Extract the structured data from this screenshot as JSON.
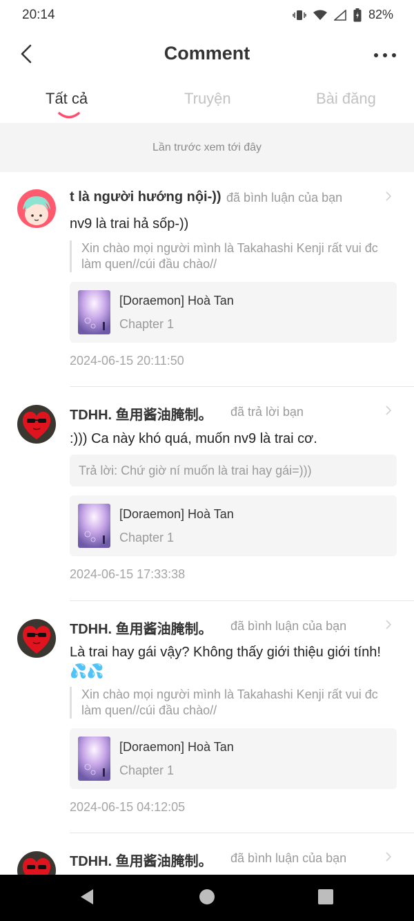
{
  "status": {
    "time": "20:14",
    "battery": "82%"
  },
  "header": {
    "title": "Comment"
  },
  "tabs": [
    {
      "label": "Tất cả"
    },
    {
      "label": "Truyện"
    },
    {
      "label": "Bài đăng"
    }
  ],
  "notice": "Lần trước xem tới đây",
  "items": [
    {
      "user": "t là người hướng nội-))",
      "action": "đã bình luận của bạn",
      "comment": "nv9 là trai hả sốp-))",
      "quote": "Xin chào mọi người mình là Takahashi Kenji rất vui đc làm quen//cúi đầu chào//",
      "story_title": "[Doraemon] Hoà Tan",
      "chapter": "Chapter 1",
      "time": "2024-06-15 20:11:50"
    },
    {
      "user": "TDHH. 鱼用酱油腌制。",
      "action": "đã trả lời bạn",
      "comment": ":))) Ca này khó quá, muốn nv9 là trai cơ.",
      "reply": "Trả lời: Chứ giờ ní muốn là trai hay gái=)))",
      "story_title": "[Doraemon] Hoà Tan",
      "chapter": "Chapter 1",
      "time": "2024-06-15 17:33:38"
    },
    {
      "user": "TDHH. 鱼用酱油腌制。",
      "action": "đã bình luận của bạn",
      "comment": "Là trai hay gái vậy? Không thấy giới thiệu giới tính! 💦💦",
      "quote": "Xin chào mọi người mình là Takahashi Kenji rất vui đc làm quen//cúi đầu chào//",
      "story_title": "[Doraemon] Hoà Tan",
      "chapter": "Chapter 1",
      "time": "2024-06-15 04:12:05"
    },
    {
      "user": "TDHH. 鱼用酱油腌制。",
      "action": "đã bình luận của bạn"
    }
  ],
  "icons": [
    "vibrate-icon",
    "wifi-icon",
    "signal-icon",
    "battery-icon",
    "back-arrow-icon",
    "more-dots-icon",
    "chevron-right-icon",
    "nav-back-icon",
    "nav-home-icon",
    "nav-recents-icon"
  ],
  "colors": {
    "accent": "#ff4d6d",
    "background": "#ffffff",
    "notice_bg": "#f4f4f4",
    "card_bg": "#f5f5f5"
  }
}
